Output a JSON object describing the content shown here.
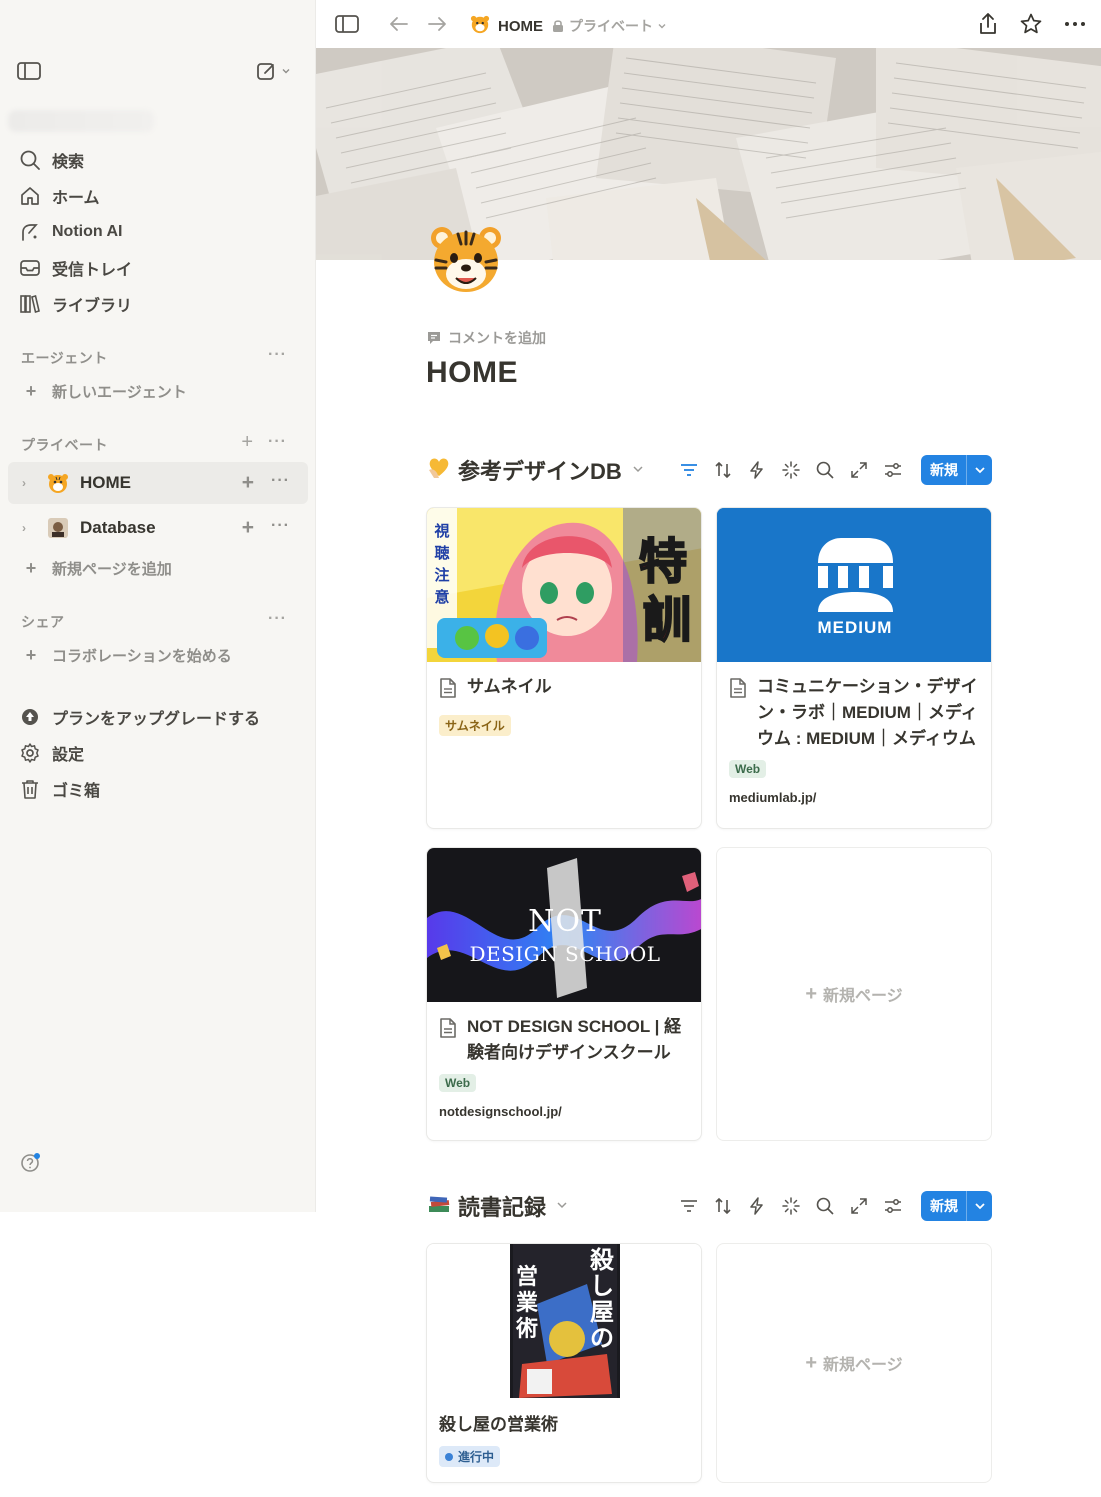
{
  "topbar": {
    "page_title": "HOME",
    "privacy": "プライベート"
  },
  "sidebar": {
    "nav": [
      {
        "label": "検索",
        "icon": "search-icon"
      },
      {
        "label": "ホーム",
        "icon": "home-icon"
      },
      {
        "label": "Notion AI",
        "icon": "notion-ai-icon"
      },
      {
        "label": "受信トレイ",
        "icon": "inbox-icon"
      },
      {
        "label": "ライブラリ",
        "icon": "library-icon"
      }
    ],
    "agents_section": "エージェント",
    "new_agent": "新しいエージェント",
    "private_section": "プライベート",
    "pages": [
      {
        "label": "HOME",
        "icon": "tiger-emoji-icon"
      },
      {
        "label": "Database",
        "icon": "database-page-icon"
      }
    ],
    "add_page": "新規ページを追加",
    "share_section": "シェア",
    "start_collab": "コラボレーションを始める",
    "bottom": [
      {
        "label": "プランをアップグレードする",
        "icon": "upgrade-icon"
      },
      {
        "label": "設定",
        "icon": "gear-icon"
      },
      {
        "label": "ゴミ箱",
        "icon": "trash-icon"
      }
    ]
  },
  "page": {
    "add_comment": "コメントを追加",
    "title": "HOME"
  },
  "db1": {
    "title": "参考デザインDB",
    "new_button": "新規",
    "cards": [
      {
        "title": "サムネイル",
        "tag": "サムネイル",
        "url": ""
      },
      {
        "title": "コミュニケーション・デザイン・ラボ｜MEDIUM｜メディウム : MEDIUM｜メディウム",
        "tag": "Web",
        "url": "mediumlab.jp/",
        "thumb_text": "MEDIUM"
      },
      {
        "title": "NOT DESIGN SCHOOL | 経験者向けデザインスクール",
        "tag": "Web",
        "url": "notdesignschool.jp/",
        "thumb_line1": "NOT",
        "thumb_line2": "DESIGN SCHOOL"
      }
    ],
    "new_page": "新規ページ"
  },
  "db2": {
    "title": "読書記録",
    "new_button": "新規",
    "cards": [
      {
        "title": "殺し屋の営業術",
        "status": "進行中"
      }
    ],
    "new_page": "新規ページ"
  },
  "colors": {
    "accent": "#2383e2",
    "sidebar_bg": "#f7f6f3",
    "medium_blue": "#1976c9"
  }
}
